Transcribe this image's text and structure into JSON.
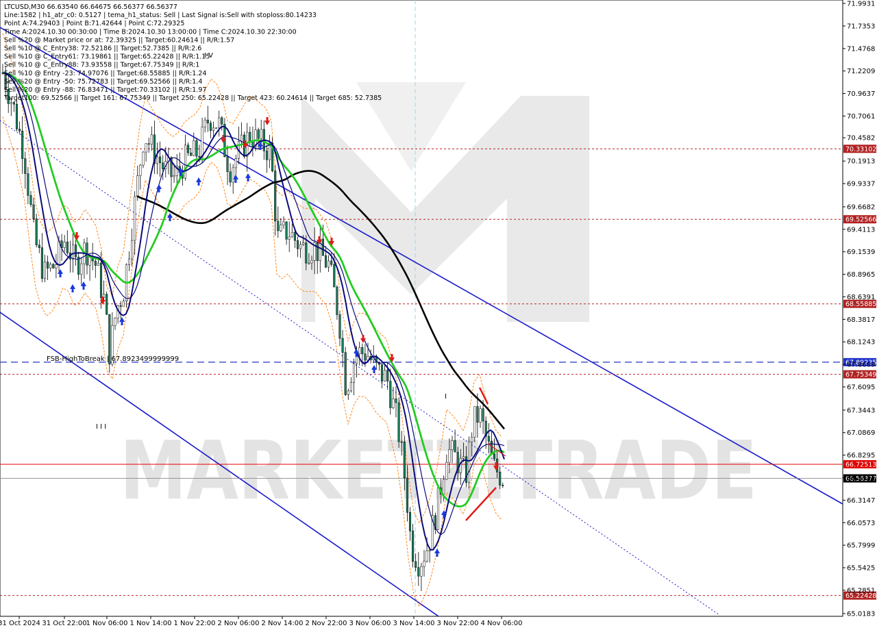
{
  "info_lines": [
    "LTCUSD,M30  66.63540 66.64675 66.56377 66.56377",
    "Line:1582 | h1_atr_c0: 0.5127 | tema_h1_status: Sell | Last Signal is:Sell with stoploss:80.14233",
    "Point A:74.29403 | Point B:71.42644 | Point C:72.29325",
    "Time A:2024.10.30 00:30:00 | Time B:2024.10.30 13:00:00 | Time C:2024.10.30 22:30:00",
    "Sell %20 @ Market price or at: 72.39325 || Target:60.24614 || R/R:1.57",
    "Sell %10 @ C_Entry38: 72.52186 || Target:52.7385 || R/R:2.6",
    "Sell %10 @ C_Entry61: 73.19861 || Target:65.22428 || R/R:1.15",
    "Sell %10 @ C_Entry88: 73.93558 || Target:67.75349 || R/R:1",
    "Sell %10 @ Entry -23: 74.97076 || Target:68.55885 || R/R:1.24",
    "Sell %20 @ Entry -50: 75.72783 || Target:69.52566 || R/R:1.4",
    "Sell %20 @ Entry -88: 76.83471 || Target:70.33102 || R/R:1.97",
    "Target100: 69.52566 || Target 161: 67.75349 || Target 250: 65.22428 || Target 423: 60.24614 || Target 685: 52.7385"
  ],
  "annotations": {
    "fsb_label": "FSB-HighToBreak | 67.8923499999999",
    "marks_top": "I V",
    "marks_bottom": "I I I",
    "mark_mid": "I"
  },
  "watermark": {
    "text": "MARKETZITRADE"
  },
  "colors": {
    "background": "#ffffff",
    "candle_body": "#1a7f5a",
    "ema_black": "#000000",
    "ema_green": "#22cc22",
    "ema_navy": "#0a0a7a",
    "channel_blue": "#1a1acc",
    "level_red": "#b22222",
    "level_blue": "#2233cc",
    "current_price_tag": "#000000",
    "buy_arrow": "#1a3ae0",
    "sell_arrow": "#e01a1a"
  },
  "chart_data": {
    "type": "candlestick",
    "symbol": "LTCUSD",
    "timeframe": "M30",
    "ylim": [
      65.0183,
      71.9931
    ],
    "y_ticks": [
      71.9931,
      71.7353,
      71.4768,
      71.2209,
      70.9637,
      70.7061,
      70.4582,
      70.1913,
      69.9337,
      69.6682,
      69.4113,
      69.1539,
      68.8965,
      68.6391,
      68.3817,
      68.1243,
      67.8669,
      67.6095,
      67.3443,
      67.0869,
      66.8295,
      66.5721,
      66.3147,
      66.0573,
      65.7999,
      65.5425,
      65.2851,
      65.0183
    ],
    "x_tick_labels": [
      "31 Oct 2024",
      "31 Oct 22:00",
      "1 Nov 06:00",
      "1 Nov 14:00",
      "1 Nov 22:00",
      "2 Nov 06:00",
      "2 Nov 14:00",
      "2 Nov 22:00",
      "3 Nov 06:00",
      "3 Nov 14:00",
      "3 Nov 22:00",
      "4 Nov 06:00"
    ],
    "levels": [
      {
        "price": 70.33102,
        "label": "70.33102",
        "style": "dotted-red"
      },
      {
        "price": 69.52566,
        "label": "69.52566",
        "style": "dotted-red"
      },
      {
        "price": 68.55885,
        "label": "68.55885",
        "style": "dotted-red"
      },
      {
        "price": 67.89235,
        "label": "67.89235",
        "style": "dashed-blue"
      },
      {
        "price": 67.75349,
        "label": "67.75349",
        "style": "dotted-red"
      },
      {
        "price": 66.72513,
        "label": "66.72513",
        "style": "solid-red"
      },
      {
        "price": 66.56377,
        "label": "66.56377",
        "style": "current-price"
      },
      {
        "price": 65.22428,
        "label": "65.22428",
        "style": "dotted-red"
      }
    ],
    "ohlc_last": {
      "open": 66.6354,
      "high": 66.64675,
      "low": 66.56377,
      "close": 66.56377
    }
  }
}
